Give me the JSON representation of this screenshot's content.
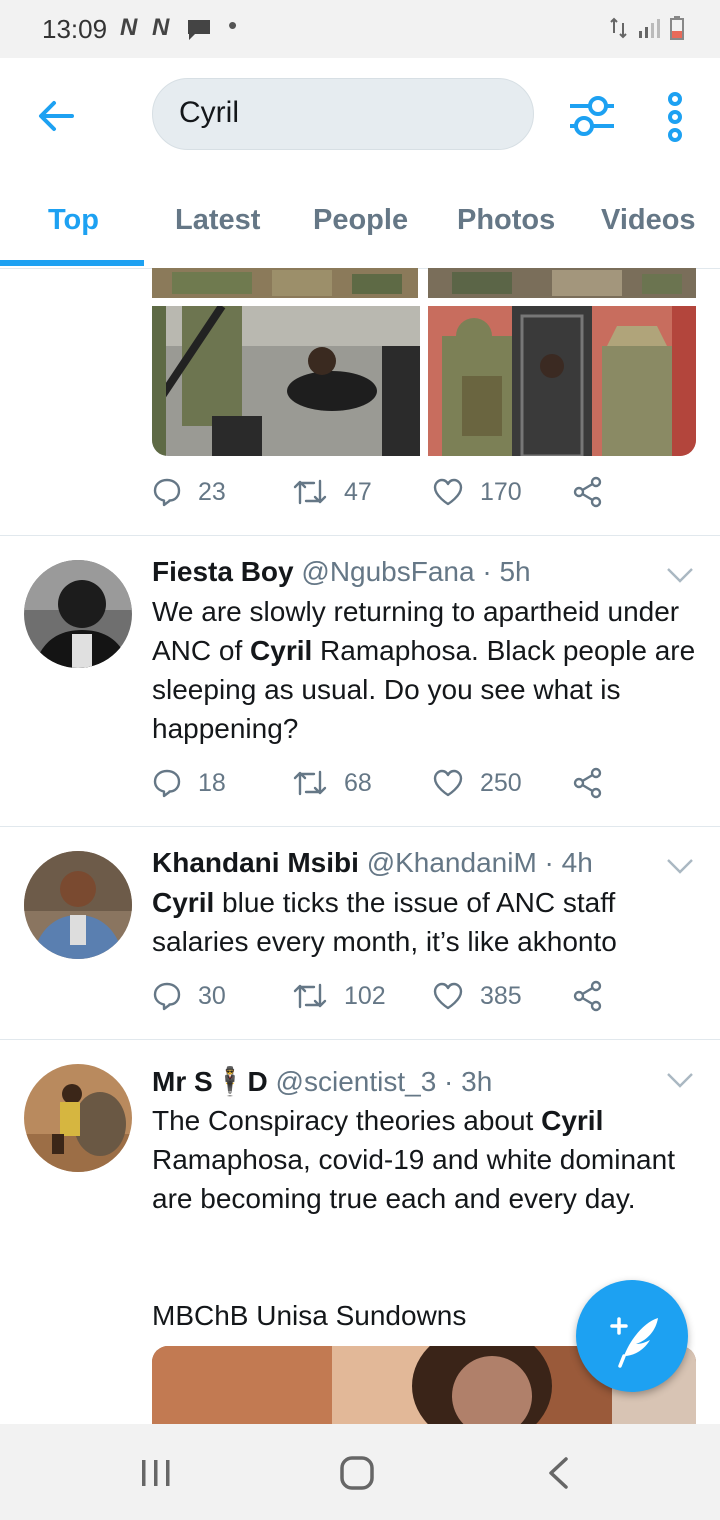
{
  "status_bar": {
    "time": "13:09",
    "notif_icons": "N N"
  },
  "search": {
    "value": "Cyril"
  },
  "tabs": [
    {
      "label": "Top",
      "active": true
    },
    {
      "label": "Latest",
      "active": false
    },
    {
      "label": "People",
      "active": false
    },
    {
      "label": "Photos",
      "active": false
    },
    {
      "label": "Videos",
      "active": false
    }
  ],
  "first_tweet_actions": {
    "replies": "23",
    "retweets": "47",
    "likes": "170"
  },
  "tweets": [
    {
      "name": "Fiesta Boy",
      "meta": "@NgubsFana · 5h",
      "text_bold": "Cyril",
      "text_before": "We are slowly returning to apartheid under ANC of ",
      "text_after": " Ramaphosa. Black people are sleeping as usual. Do you see what is happening?",
      "replies": "18",
      "retweets": "68",
      "likes": "250"
    },
    {
      "name": "Khandani Msibi",
      "meta": "@KhandaniM · 4h",
      "text_bold": "Cyril",
      "text_before": "",
      "text_after": " blue ticks the issue of ANC staff salaries every month, it’s like akhonto",
      "replies": "30",
      "retweets": "102",
      "likes": "385"
    },
    {
      "name": "Mr S🕴D",
      "meta": "@scientist_3 · 3h",
      "text_bold": "Cyril",
      "text_before": "The Conspiracy theories about ",
      "text_after": " Ramaphosa, covid-19 and white dominant are becoming true each and every day.",
      "extra": "MBChB Unisa Sundowns"
    }
  ],
  "colors": {
    "accent": "#1da1f2",
    "secondary_text": "#657786",
    "divider": "#e1e8ed"
  }
}
